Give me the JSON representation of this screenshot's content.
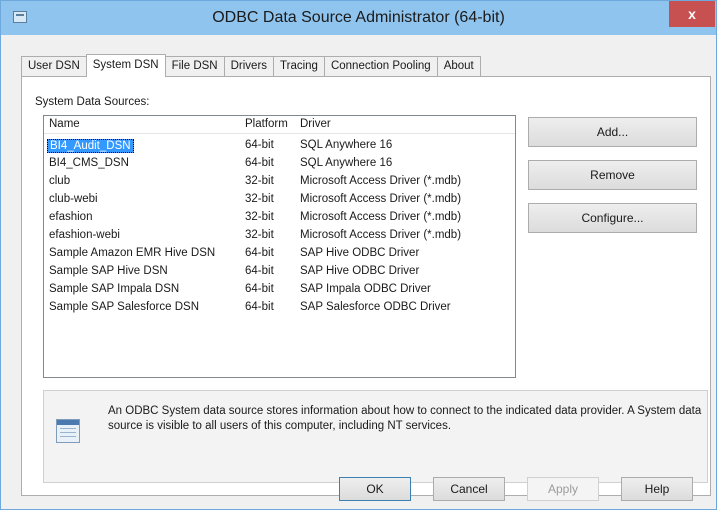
{
  "window": {
    "title": "ODBC Data Source Administrator (64-bit)",
    "close_label": "x"
  },
  "tabs": [
    {
      "label": "User DSN",
      "active": false
    },
    {
      "label": "System DSN",
      "active": true
    },
    {
      "label": "File DSN",
      "active": false
    },
    {
      "label": "Drivers",
      "active": false
    },
    {
      "label": "Tracing",
      "active": false
    },
    {
      "label": "Connection Pooling",
      "active": false
    },
    {
      "label": "About",
      "active": false
    }
  ],
  "panel": {
    "section_label": "System Data Sources:",
    "columns": {
      "name": "Name",
      "platform": "Platform",
      "driver": "Driver"
    },
    "rows": [
      {
        "name": "BI4_Audit_DSN",
        "platform": "64-bit",
        "driver": "SQL Anywhere 16",
        "selected": true
      },
      {
        "name": "BI4_CMS_DSN",
        "platform": "64-bit",
        "driver": "SQL Anywhere 16"
      },
      {
        "name": "club",
        "platform": "32-bit",
        "driver": "Microsoft Access Driver (*.mdb)"
      },
      {
        "name": "club-webi",
        "platform": "32-bit",
        "driver": "Microsoft Access Driver (*.mdb)"
      },
      {
        "name": "efashion",
        "platform": "32-bit",
        "driver": "Microsoft Access Driver (*.mdb)"
      },
      {
        "name": "efashion-webi",
        "platform": "32-bit",
        "driver": "Microsoft Access Driver (*.mdb)"
      },
      {
        "name": "Sample Amazon EMR Hive DSN",
        "platform": "64-bit",
        "driver": "SAP Hive ODBC Driver"
      },
      {
        "name": "Sample SAP Hive DSN",
        "platform": "64-bit",
        "driver": "SAP Hive ODBC Driver"
      },
      {
        "name": "Sample SAP Impala DSN",
        "platform": "64-bit",
        "driver": "SAP Impala ODBC Driver"
      },
      {
        "name": "Sample SAP Salesforce DSN",
        "platform": "64-bit",
        "driver": "SAP Salesforce ODBC Driver"
      }
    ],
    "buttons": {
      "add": "Add...",
      "remove": "Remove",
      "configure": "Configure..."
    },
    "info_text": "An ODBC System data source stores information about how to connect to the indicated data provider. A System data source is visible to all users of this computer, including NT services."
  },
  "footer": {
    "ok": "OK",
    "cancel": "Cancel",
    "apply": "Apply",
    "help": "Help"
  },
  "colors": {
    "titlebar": "#8fc4ee",
    "selection": "#3399ff",
    "close": "#c75050"
  },
  "icons": {
    "system": "window-icon",
    "info": "data-source-icon",
    "close": "close-icon"
  }
}
